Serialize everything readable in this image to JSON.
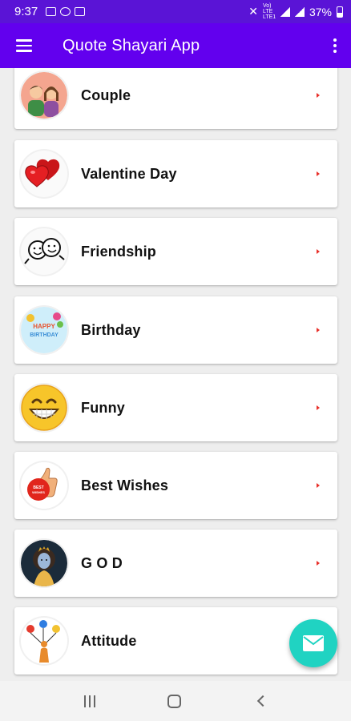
{
  "status_bar": {
    "time": "9:37",
    "battery": "37%",
    "network_label": "Vo) LTE LTE1"
  },
  "app_bar": {
    "title": "Quote Shayari App",
    "menu_icon": "hamburger-menu-icon",
    "overflow_icon": "overflow-menu-icon"
  },
  "categories": [
    {
      "label": "Couple",
      "icon": "couple-icon"
    },
    {
      "label": "Valentine Day",
      "icon": "hearts-icon"
    },
    {
      "label": "Friendship",
      "icon": "friendship-icon"
    },
    {
      "label": "Birthday",
      "icon": "birthday-icon"
    },
    {
      "label": "Funny",
      "icon": "smiley-icon"
    },
    {
      "label": "Best Wishes",
      "icon": "thumbs-up-icon"
    },
    {
      "label": "G O D",
      "icon": "god-icon"
    },
    {
      "label": "Attitude",
      "icon": "attitude-icon"
    }
  ],
  "avatar_text": {
    "birthday": "HAPPY BIRTHDAY",
    "best_wishes": "BEST WISHES"
  },
  "fab": {
    "icon": "mail-icon"
  },
  "colors": {
    "status_bar": "#5a14d6",
    "app_bar": "#6200ee",
    "fab": "#20d3c2",
    "chevron": "#e8302a"
  }
}
